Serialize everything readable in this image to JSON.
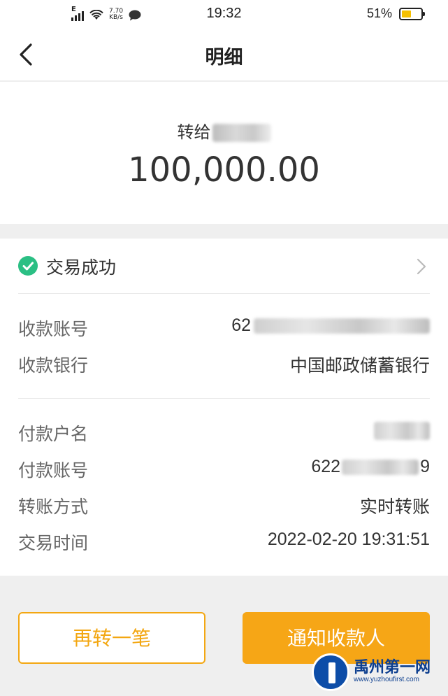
{
  "status_bar": {
    "network": "E",
    "speed_value": "7.70",
    "speed_unit": "KB/s",
    "time": "19:32",
    "battery_pct": "51%",
    "battery_level": 0.51,
    "battery_color": "#f6c000"
  },
  "nav": {
    "title": "明细",
    "back_icon": "chevron-left-icon"
  },
  "summary": {
    "recipient_prefix": "转给",
    "amount": "100,000.00"
  },
  "status": {
    "text": "交易成功",
    "icon": "check-circle-icon",
    "color": "#2bbf84"
  },
  "payee": {
    "account_label": "收款账号",
    "account_value": "62",
    "bank_label": "收款银行",
    "bank_value": "中国邮政储蓄银行"
  },
  "payer": {
    "name_label": "付款户名",
    "account_label": "付款账号",
    "account_prefix": "622",
    "account_suffix": "9",
    "method_label": "转账方式",
    "method_value": "实时转账",
    "time_label": "交易时间",
    "time_value": "2022-02-20 19:31:51"
  },
  "buttons": {
    "again": "再转一笔",
    "notify": "通知收款人",
    "accent_color": "#f6a616"
  },
  "watermark": {
    "name": "禹州第一网",
    "url": "www.yuzhoufirst.com"
  }
}
